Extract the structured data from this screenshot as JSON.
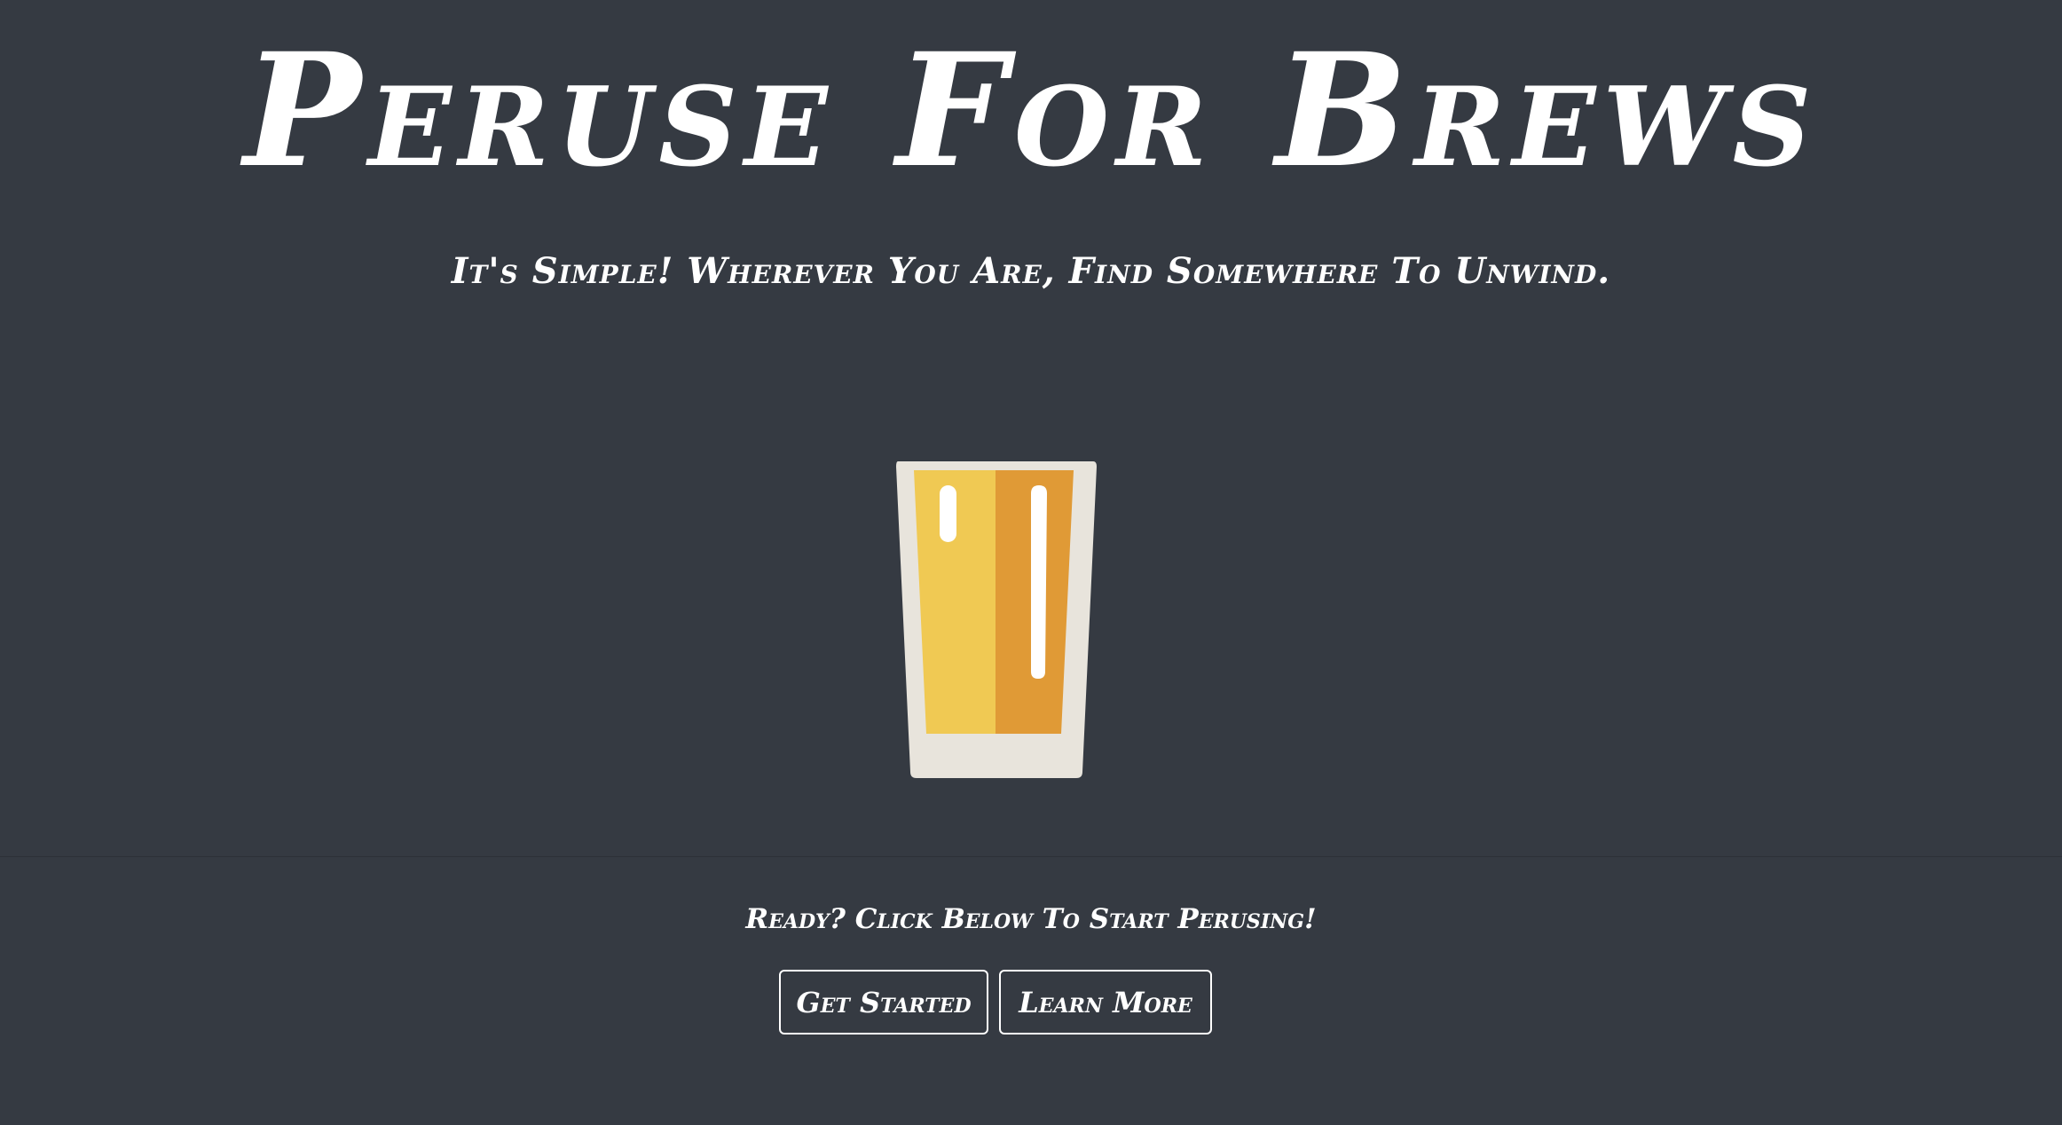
{
  "hero": {
    "title": "Peruse For Brews",
    "subtitle": "It's Simple! Wherever You Are, Find Somewhere To Unwind.",
    "icon": "beer-glass-icon"
  },
  "cta": {
    "prompt": "Ready? Click Below To Start Perusing!",
    "get_started_label": "Get Started",
    "learn_more_label": "Learn More"
  },
  "colors": {
    "background": "#353a42",
    "text": "#ffffff",
    "glass_rim": "#e8e4dc",
    "beer_light": "#f0c953",
    "beer_dark": "#e09a36"
  }
}
